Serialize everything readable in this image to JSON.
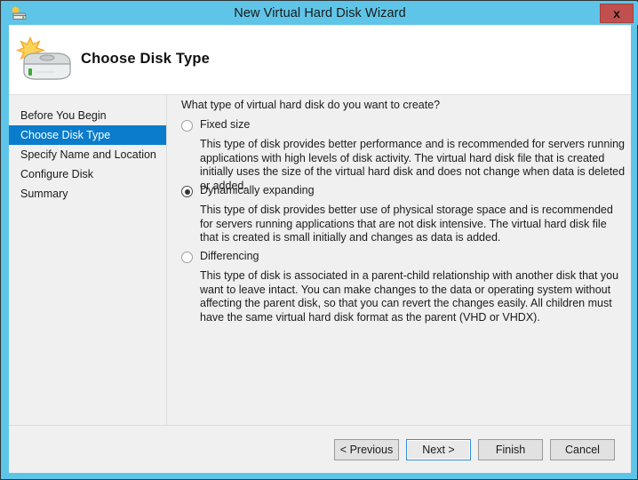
{
  "window": {
    "title": "New Virtual Hard Disk Wizard",
    "title_icon": "hard-disk-new-icon",
    "close_label": "x",
    "accent_blue": "#5fc5e8",
    "selection_blue": "#0a7ccb",
    "close_red": "#c0504d"
  },
  "header": {
    "title": "Choose Disk Type",
    "icon": "hard-disk-icon"
  },
  "sidebar": {
    "items": [
      {
        "label": "Before You Begin",
        "selected": false
      },
      {
        "label": "Choose Disk Type",
        "selected": true
      },
      {
        "label": "Specify Name and Location",
        "selected": false
      },
      {
        "label": "Configure Disk",
        "selected": false
      },
      {
        "label": "Summary",
        "selected": false
      }
    ]
  },
  "content": {
    "question": "What type of virtual hard disk do you want to create?",
    "options": [
      {
        "label": "Fixed size",
        "checked": false,
        "description": "This type of disk provides better performance and is recommended for servers running applications with high levels of disk activity. The virtual hard disk file that is created initially uses the size of the virtual hard disk and does not change when data is deleted or added."
      },
      {
        "label": "Dynamically expanding",
        "checked": true,
        "description": "This type of disk provides better use of physical storage space and is recommended for servers running applications that are not disk intensive. The virtual hard disk file that is created is small initially and changes as data is added."
      },
      {
        "label": "Differencing",
        "checked": false,
        "description": "This type of disk is associated in a parent-child relationship with another disk that you want to leave intact. You can make changes to the data or operating system without affecting the parent disk, so that you can revert the changes easily. All children must have the same virtual hard disk format as the parent (VHD or VHDX)."
      }
    ]
  },
  "footer": {
    "previous_label": "< Previous",
    "next_label": "Next >",
    "finish_label": "Finish",
    "cancel_label": "Cancel",
    "default_button": "next"
  }
}
